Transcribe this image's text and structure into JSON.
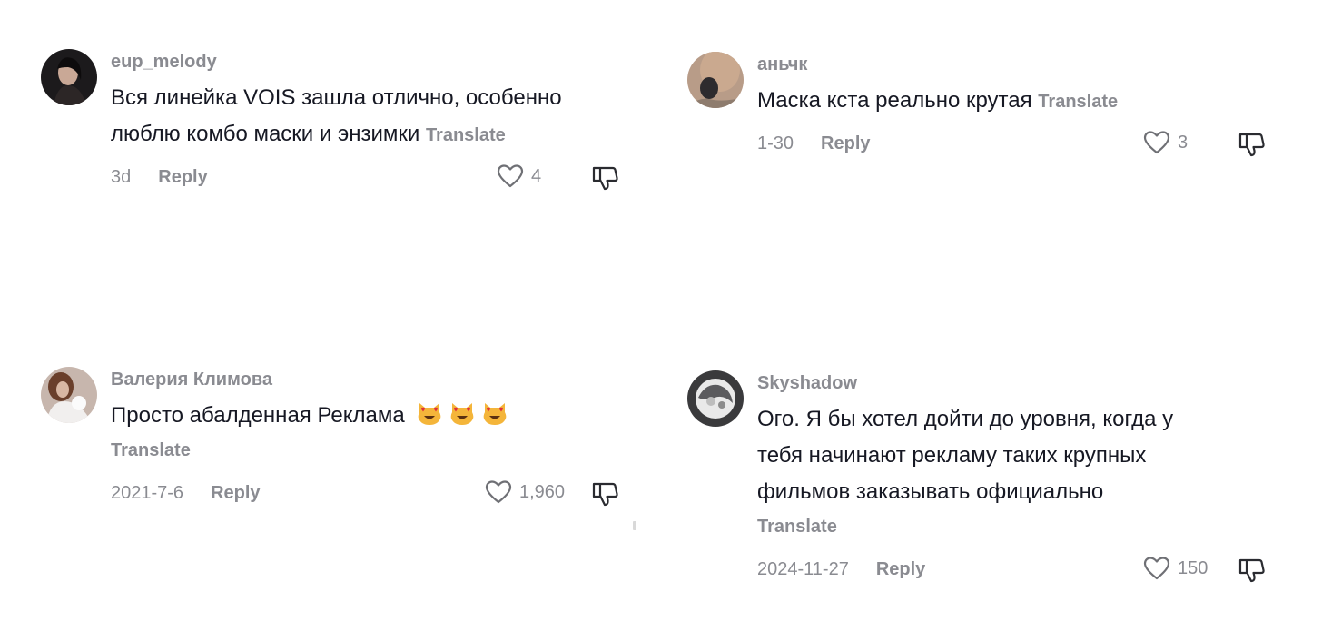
{
  "comments": [
    {
      "username": "eup_melody",
      "text_lines": [
        "Вся линейка VOIS зашла отлично, особенно",
        "люблю комбо маски и энзимки"
      ],
      "translate": "Translate",
      "date": "3d",
      "reply": "Reply",
      "likes": "4"
    },
    {
      "username": "аньчк",
      "text_lines": [
        "Маска кста реально крутая"
      ],
      "translate": "Translate",
      "date": "1-30",
      "reply": "Reply",
      "likes": "3"
    },
    {
      "username": "Валерия Климова",
      "text_lines": [
        "Просто абалденная Реклама"
      ],
      "emojis": [
        "heart-eyes-cat-emoji",
        "heart-eyes-cat-emoji",
        "heart-eyes-cat-emoji"
      ],
      "translate": "Translate",
      "date": "2021-7-6",
      "reply": "Reply",
      "likes": "1,960"
    },
    {
      "username": "Skyshadow",
      "text_lines": [
        "Ого. Я бы хотел дойти до уровня, когда у",
        "тебя начинают рекламу таких крупных",
        "фильмов заказывать официально"
      ],
      "translate": "Translate",
      "date": "2024-11-27",
      "reply": "Reply",
      "likes": "150"
    }
  ],
  "icons": {
    "like": "heart-outline-icon",
    "dislike": "thumbs-down-icon"
  },
  "colors": {
    "text": "#161823",
    "secondary": "#8a8b91"
  }
}
